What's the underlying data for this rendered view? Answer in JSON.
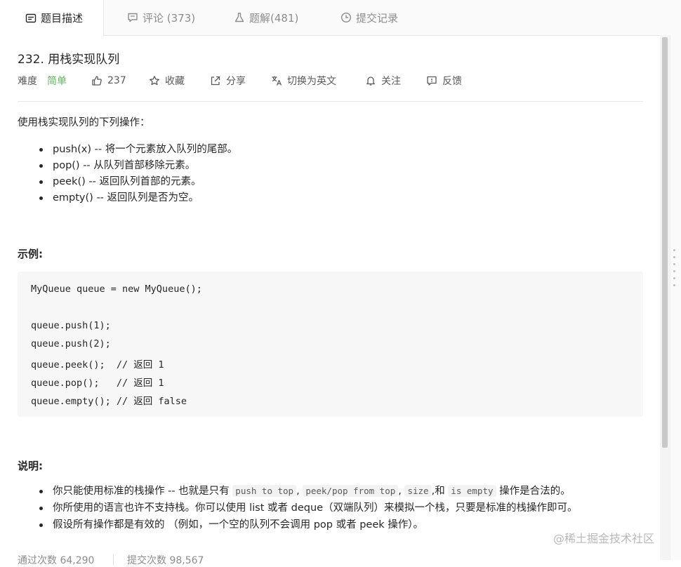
{
  "tabs": [
    {
      "label": "题目描述",
      "icon": "description-icon"
    },
    {
      "label": "评论 (373)",
      "icon": "comment-icon"
    },
    {
      "label": "题解(481)",
      "icon": "flask-icon"
    },
    {
      "label": "提交记录",
      "icon": "clock-icon"
    }
  ],
  "problem": {
    "title": "232. 用栈实现队列",
    "difficulty_label": "难度",
    "difficulty": "简单",
    "likes": "237",
    "favorite": "收藏",
    "share": "分享",
    "switch_lang": "切换为英文",
    "follow": "关注",
    "feedback": "反馈"
  },
  "description": {
    "intro": "使用栈实现队列的下列操作：",
    "operations": [
      "push(x) -- 将一个元素放入队列的尾部。",
      "pop() -- 从队列首部移除元素。",
      "peek() -- 返回队列首部的元素。",
      "empty() -- 返回队列是否为空。"
    ]
  },
  "example": {
    "heading": "示例:",
    "code_lines": [
      "MyQueue queue = new MyQueue();",
      "",
      "queue.push(1);",
      "queue.push(2);",
      "queue.peek();  // 返回 1",
      "queue.pop();   // 返回 1",
      "queue.empty(); // 返回 false"
    ]
  },
  "notes": {
    "heading": "说明:",
    "item1_pre": "你只能使用标准的栈操作 -- 也就是只有",
    "item1_code1": "push to top",
    "item1_code2": "peek/pop from top",
    "item1_code3": "size",
    "item1_and": "和",
    "item1_code4": "is empty",
    "item1_post": "操作是合法的。",
    "sep": ",",
    "item2": "你所使用的语言也许不支持栈。你可以使用 list 或者 deque（双端队列）来模拟一个栈，只要是标准的栈操作即可。",
    "item3": "假设所有操作都是有效的 （例如，一个空的队列不会调用 pop 或者 peek 操作）。"
  },
  "stats": {
    "accepted": "通过次数 64,290",
    "submissions": "提交次数 98,567"
  },
  "watermark": "@稀土掘金技术社区"
}
